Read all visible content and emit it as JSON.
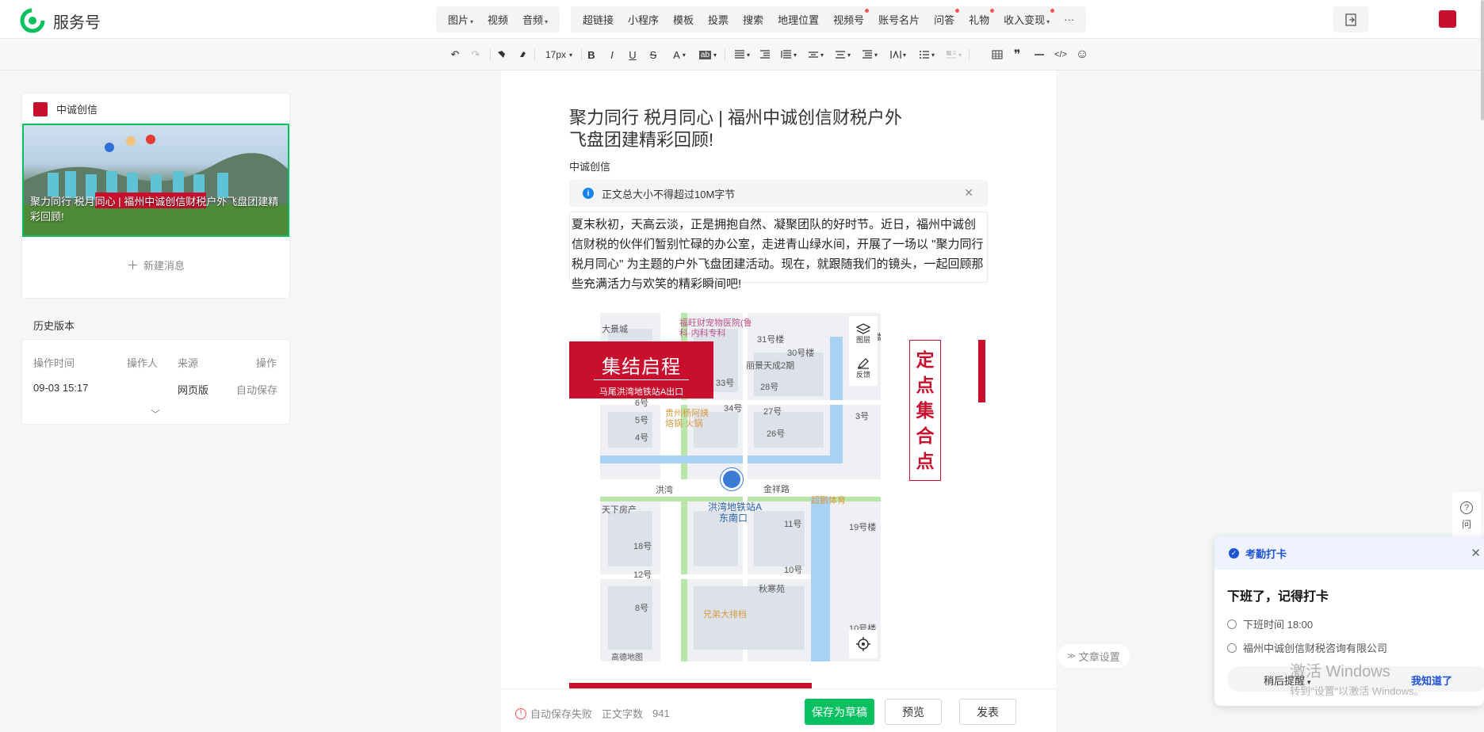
{
  "brand": {
    "name": "服务号"
  },
  "top_menu_media": [
    {
      "label": "图片",
      "caret": "▾"
    },
    {
      "label": "视频"
    },
    {
      "label": "音频",
      "caret": "▾"
    }
  ],
  "top_menu_insert": [
    {
      "label": "超链接"
    },
    {
      "label": "小程序"
    },
    {
      "label": "模板"
    },
    {
      "label": "投票"
    },
    {
      "label": "搜索"
    },
    {
      "label": "地理位置"
    },
    {
      "label": "视频号",
      "dot": true
    },
    {
      "label": "账号名片"
    },
    {
      "label": "问答",
      "dot": true
    },
    {
      "label": "礼物",
      "dot": true
    },
    {
      "label": "收入变现",
      "caret": "▾",
      "dot": true
    },
    {
      "label": "···"
    }
  ],
  "toolbar": {
    "font_size": "17px",
    "bold": "B",
    "italic": "I",
    "underline": "U",
    "strike": "S",
    "font_color": "A",
    "bg_color": "ab",
    "quote": "❞",
    "code": "</>",
    "emoji": "☺"
  },
  "left": {
    "account_name": "中诚创信",
    "cover_caption": "聚力同行 税月同心 | 福州中诚创信财税户外飞盘团建精彩回顾!",
    "new_message": "新建消息",
    "history_title": "历史版本",
    "history_headers": {
      "time": "操作时间",
      "operator": "操作人",
      "source": "来源",
      "action": "操作"
    },
    "history_row": {
      "time": "09-03 15:17",
      "operator": "",
      "source": "网页版",
      "action": "自动保存"
    }
  },
  "article": {
    "title": "聚力同行 税月同心 | 福州中诚创信财税户外飞盘团建精彩回顾!",
    "author": "中诚创信",
    "notice": "正文总大小不得超过10M字节",
    "paragraph": "夏末秋初，天高云淡，正是拥抱自然、凝聚团队的好时节。近日，福州中诚创信财税的伙伴们暂别忙碌的办公室，走进青山绿水间，开展了一场以 \"聚力同行 税月同心\" 为主题的户外飞盘团建活动。现在，就跟随我们的镜头，一起回顾那些充满活力与欢笑的精彩瞬间吧!",
    "banner_title": "集结启程",
    "banner_sub": "马尾洪湾地铁站A出口",
    "vertical_text": "定点集合点",
    "map": {
      "layers": "图层",
      "feedback": "反馈",
      "station": "洪湾地铁站A",
      "station2": "东南口",
      "poi1": "福旺财宠物医院(鲁",
      "poi1b": "科·内科专科",
      "poi2": "丽景天成2期",
      "poi3": "贵州杨阿姨",
      "poi3b": "烙锅·火锅",
      "poi4": "金祥路",
      "poi5": "洪湾",
      "poi6": "秋寒苑",
      "poi7": "兄弟大排档",
      "poi8": "超鹏体育",
      "poi9": "天下房产",
      "poi10": "大景城",
      "logo": "高德地图",
      "nums": [
        "31号楼",
        "30号楼",
        "33号",
        "28号",
        "34号",
        "27号",
        "26号",
        "6号",
        "5号",
        "4号",
        "3号",
        "11号",
        "19号楼",
        "18号",
        "12号",
        "10号",
        "8号",
        "10号楼"
      ]
    }
  },
  "bottom": {
    "autosave": "自动保存失败",
    "word_label": "正文字数",
    "word_count": "941",
    "save_draft": "保存为草稿",
    "preview": "预览",
    "publish": "发表"
  },
  "right": {
    "article_settings": "文章设置",
    "help": "问",
    "popup": {
      "header": "考勤打卡",
      "title": "下班了，记得打卡",
      "time": "下班时间 18:00",
      "company": "福州中诚创信财税咨询有限公司",
      "later": "稍后提醒",
      "ok": "我知道了"
    },
    "watermark1": "激活 Windows",
    "watermark2": "转到\"设置\"以激活 Windows。"
  },
  "colors": {
    "accent": "#07c160",
    "brand_red": "#c8102e",
    "link_blue": "#1f52d6"
  }
}
